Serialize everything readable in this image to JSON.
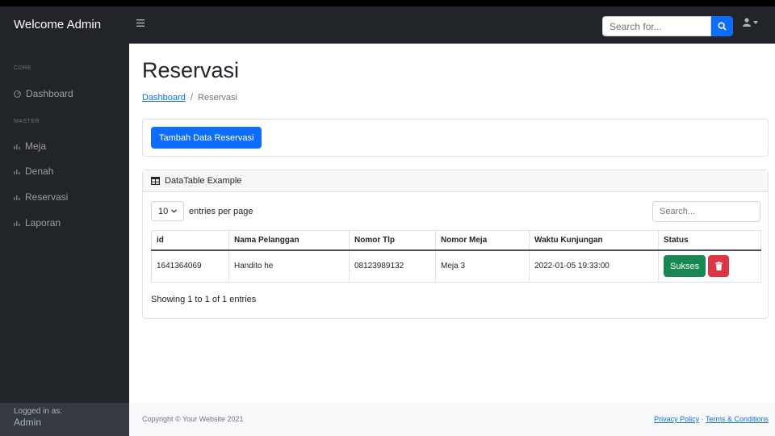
{
  "navbar": {
    "brand": "Welcome Admin",
    "toggle_icon": "bars-icon",
    "search_placeholder": "Search for...",
    "search_icon": "search-icon",
    "user_icon": "user-icon"
  },
  "sidebar": {
    "heading_core": "CORE",
    "heading_master": "MASTER",
    "items": [
      {
        "label": "Dashboard",
        "icon": "tachometer-icon"
      },
      {
        "label": "Meja",
        "icon": "chart-icon"
      },
      {
        "label": "Denah",
        "icon": "chart-icon"
      },
      {
        "label": "Reservasi",
        "icon": "chart-icon"
      },
      {
        "label": "Laporan",
        "icon": "chart-icon"
      }
    ],
    "footer_label": "Logged in as:",
    "footer_user": "Admin"
  },
  "page": {
    "title": "Reservasi",
    "breadcrumb_link": "Dashboard",
    "breadcrumb_sep": "/",
    "breadcrumb_current": "Reservasi",
    "add_button": "Tambah Data Reservasi"
  },
  "datatable": {
    "header": "DataTable Example",
    "per_page_value": "10",
    "per_page_label": "entries per page",
    "search_placeholder": "Search...",
    "columns": [
      "id",
      "Nama Pelanggan",
      "Nomor Tlp",
      "Nomor Meja",
      "Waktu Kunjungan",
      "Status"
    ],
    "rows": [
      {
        "id": "1641364069",
        "nama": "Handito he",
        "tlp": "08123989132",
        "meja": "Meja 3",
        "waktu": "2022-01-05 19:33:00",
        "status_button": "Sukses"
      }
    ],
    "info": "Showing 1 to 1 of 1 entries"
  },
  "footer": {
    "copyright": "Copyright © Your Website 2021",
    "privacy": "Privacy Policy",
    "separator": "·",
    "terms": "Terms & Conditions"
  },
  "colors": {
    "primary": "#0d6efd",
    "success": "#198754",
    "danger": "#dc3545",
    "dark": "#212529"
  }
}
